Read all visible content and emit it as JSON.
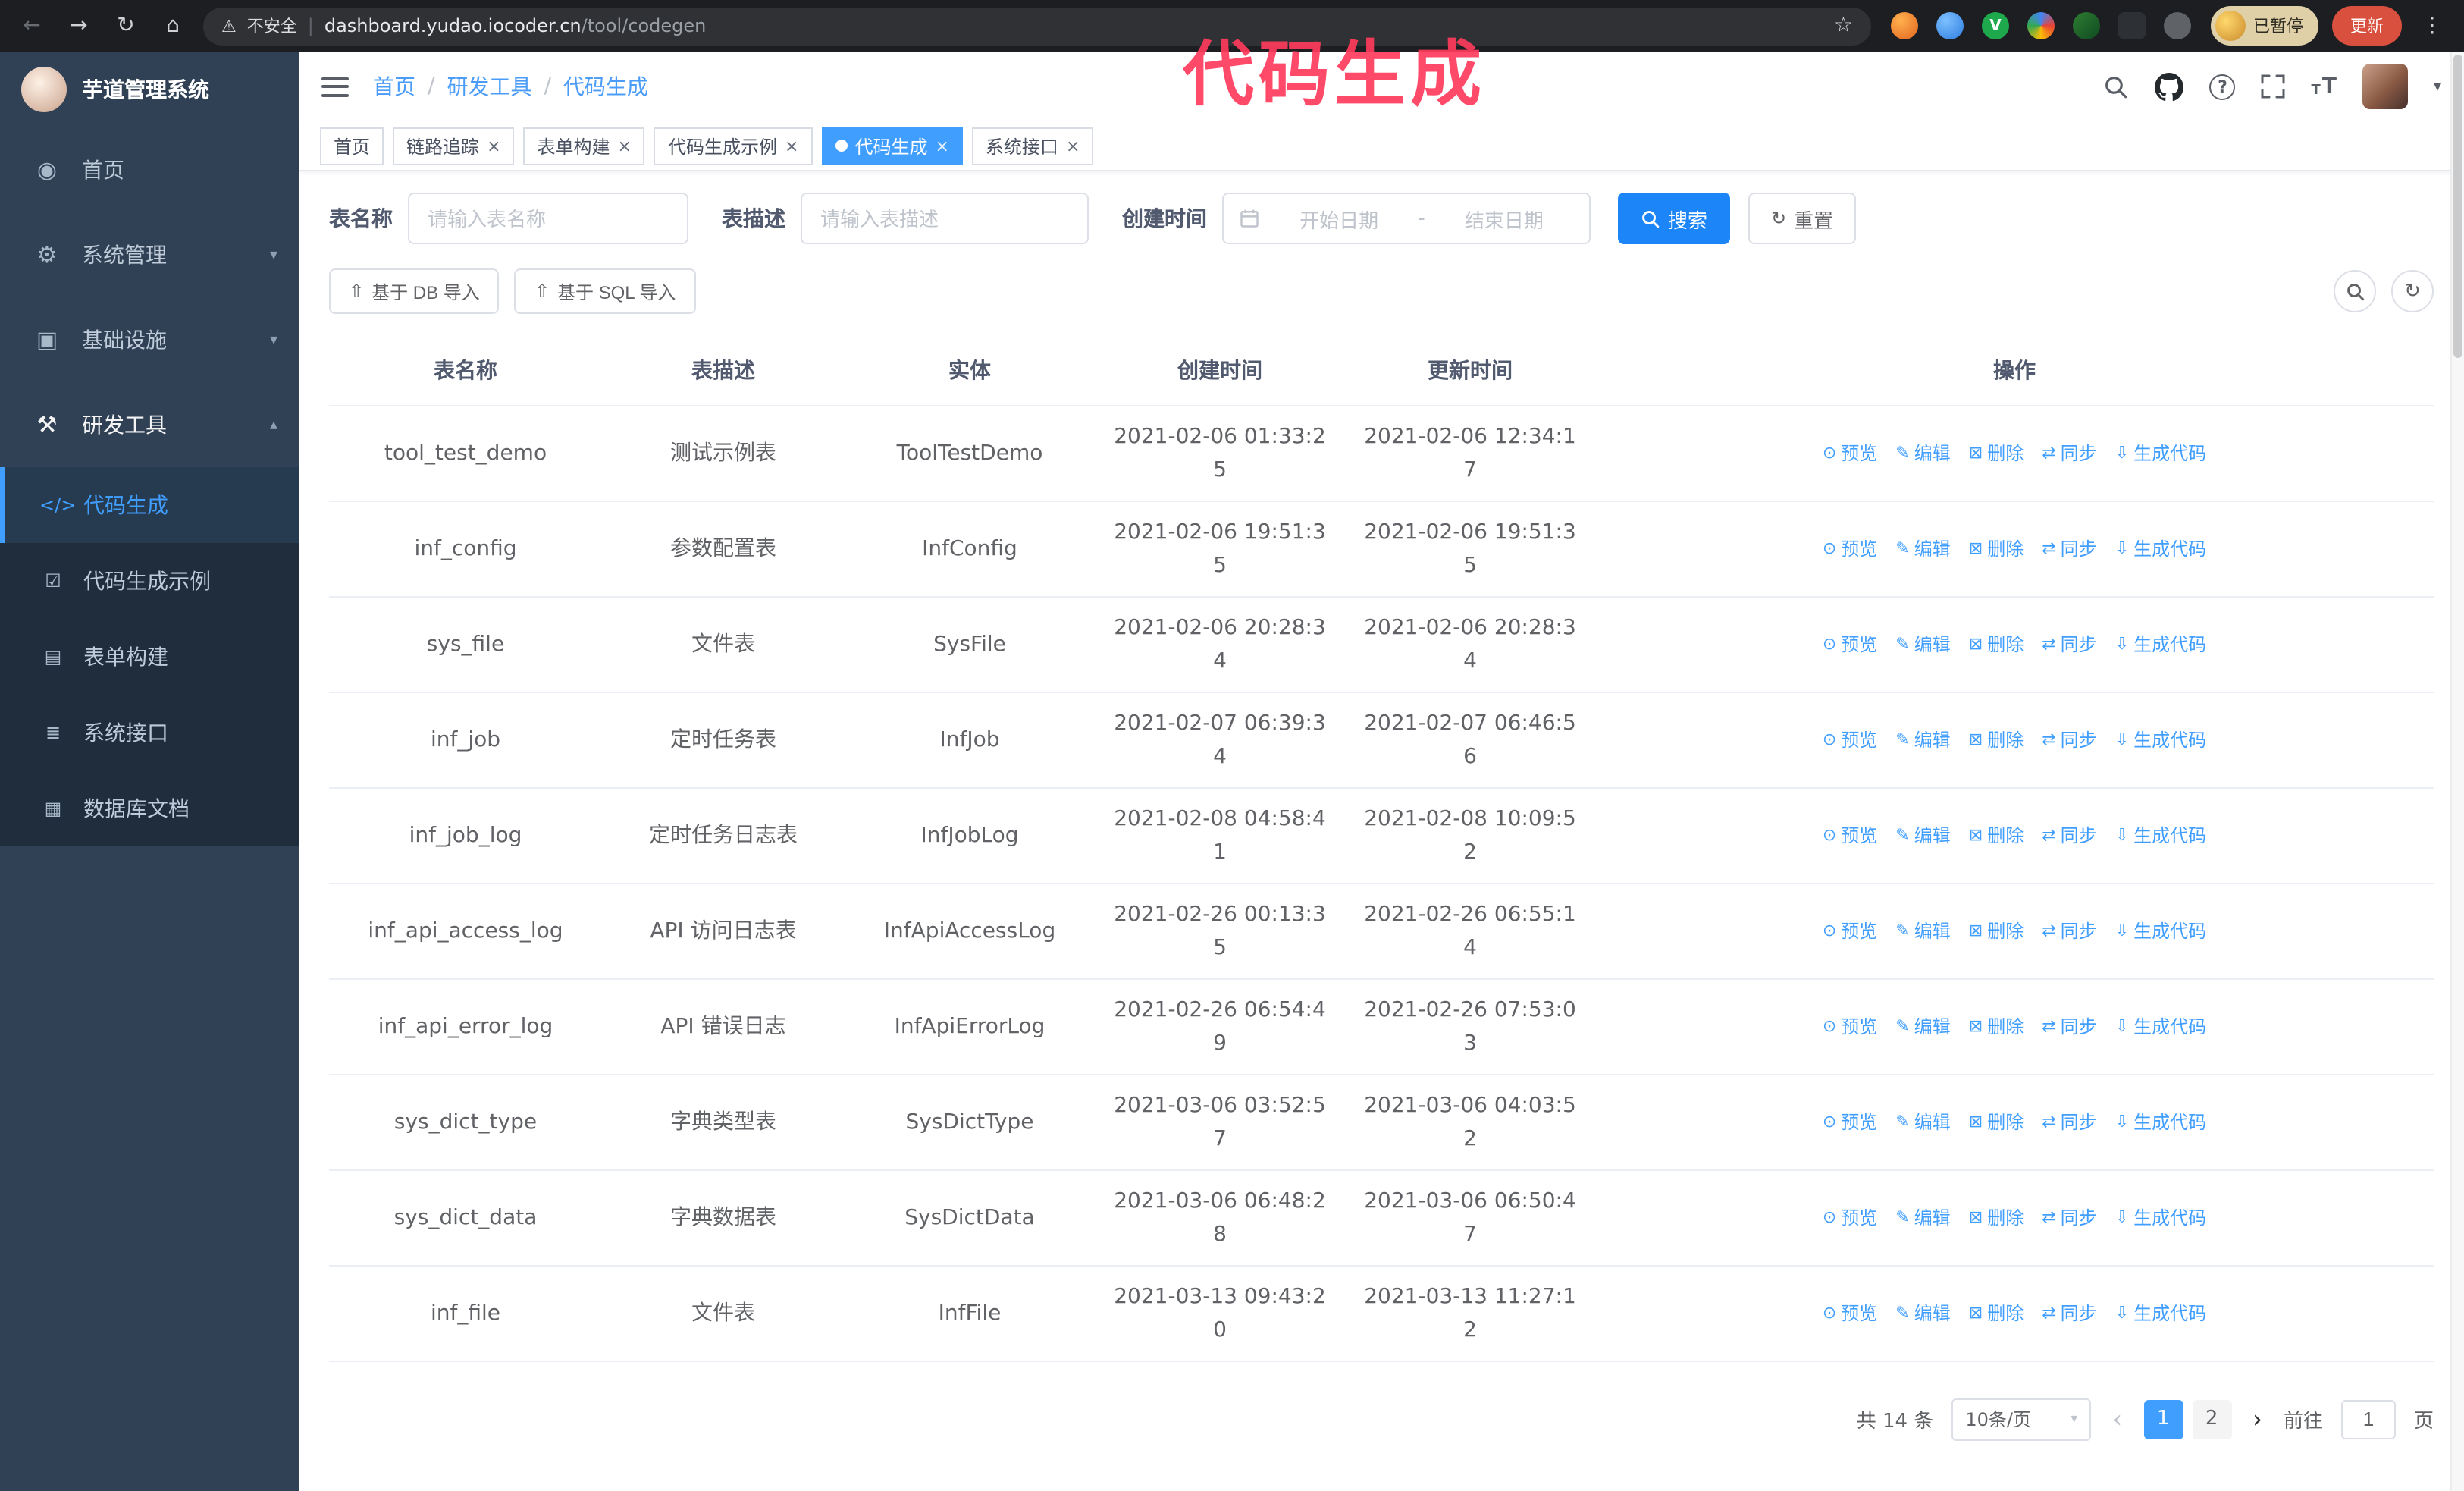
{
  "colors": {
    "accent": "#409eff",
    "primary_button": "#1c86f9",
    "sidebar_bg": "#304156",
    "submenu_bg": "#1f2d3d",
    "annotation": "#ff3b5c",
    "active_tab_bg": "#409eff"
  },
  "icons": {
    "back": "←",
    "forward": "→",
    "reload": "↻",
    "home": "⌂",
    "warning": "⚠",
    "star": "☆",
    "kebab": "⋮",
    "ext_v": "V",
    "dashboard": "◉",
    "gear": "⚙",
    "infrastructure": "▣",
    "devtools": "⚒",
    "code": "</>",
    "example": "☑",
    "form": "▤",
    "api": "≣",
    "database": "▦",
    "preview": "⊙",
    "edit": "✎",
    "delete": "⊠",
    "sync": "⇄",
    "generate": "⇩",
    "chevron_down": "▾",
    "chevron_up": "▴",
    "refresh": "↻",
    "upload": "⇧",
    "help": "?",
    "close": "×",
    "font_size_small": "T",
    "font_size_large": "T",
    "prev": "‹",
    "next": "›"
  },
  "browser": {
    "security_label": "不安全",
    "url_domain": "dashboard.yudao.iocoder.cn",
    "url_path": "/tool/codegen",
    "paused_badge": "已暂停",
    "update_button": "更新"
  },
  "annotation": {
    "text": "代码生成"
  },
  "sidebar": {
    "title": "芋道管理系统",
    "items": [
      {
        "id": "home",
        "label": "首页",
        "icon": "dashboard",
        "chevron": null,
        "open": false
      },
      {
        "id": "system",
        "label": "系统管理",
        "icon": "gear",
        "chevron": "down",
        "open": false
      },
      {
        "id": "infrastructure",
        "label": "基础设施",
        "icon": "infrastructure",
        "chevron": "down",
        "open": false
      },
      {
        "id": "devtools",
        "label": "研发工具",
        "icon": "devtools",
        "chevron": "up",
        "open": true
      }
    ],
    "sub_items": [
      {
        "id": "codegen",
        "label": "代码生成",
        "icon": "code",
        "active": true
      },
      {
        "id": "codegen-example",
        "label": "代码生成示例",
        "icon": "example",
        "active": false
      },
      {
        "id": "form-builder",
        "label": "表单构建",
        "icon": "form",
        "active": false
      },
      {
        "id": "api",
        "label": "系统接口",
        "icon": "api",
        "active": false
      },
      {
        "id": "db-doc",
        "label": "数据库文档",
        "icon": "database",
        "active": false
      }
    ]
  },
  "header": {
    "breadcrumb": [
      "首页",
      "研发工具",
      "代码生成"
    ]
  },
  "tabs": [
    {
      "id": "home",
      "label": "首页",
      "closable": false,
      "active": false
    },
    {
      "id": "tracing",
      "label": "链路追踪",
      "closable": true,
      "active": false
    },
    {
      "id": "form-builder",
      "label": "表单构建",
      "closable": true,
      "active": false
    },
    {
      "id": "codegen-example",
      "label": "代码生成示例",
      "closable": true,
      "active": false
    },
    {
      "id": "codegen",
      "label": "代码生成",
      "closable": true,
      "active": true
    },
    {
      "id": "api",
      "label": "系统接口",
      "closable": true,
      "active": false
    }
  ],
  "filters": {
    "table_name_label": "表名称",
    "table_name_placeholder": "请输入表名称",
    "table_desc_label": "表描述",
    "table_desc_placeholder": "请输入表描述",
    "create_time_label": "创建时间",
    "date_start_placeholder": "开始日期",
    "date_separator": "-",
    "date_end_placeholder": "结束日期",
    "search_button": "搜索",
    "reset_button": "重置"
  },
  "toolbar": {
    "import_db": "基于 DB 导入",
    "import_sql": "基于 SQL 导入"
  },
  "table": {
    "columns": [
      "表名称",
      "表描述",
      "实体",
      "创建时间",
      "更新时间",
      "操作"
    ],
    "actions": [
      {
        "id": "preview",
        "label": "预览",
        "icon": "preview"
      },
      {
        "id": "edit",
        "label": "编辑",
        "icon": "edit"
      },
      {
        "id": "delete",
        "label": "删除",
        "icon": "delete"
      },
      {
        "id": "sync",
        "label": "同步",
        "icon": "sync"
      },
      {
        "id": "generate",
        "label": "生成代码",
        "icon": "generate"
      }
    ],
    "rows": [
      {
        "name": "tool_test_demo",
        "desc": "测试示例表",
        "entity": "ToolTestDemo",
        "created": "2021-02-06 01:33:25",
        "updated": "2021-02-06 12:34:17"
      },
      {
        "name": "inf_config",
        "desc": "参数配置表",
        "entity": "InfConfig",
        "created": "2021-02-06 19:51:35",
        "updated": "2021-02-06 19:51:35"
      },
      {
        "name": "sys_file",
        "desc": "文件表",
        "entity": "SysFile",
        "created": "2021-02-06 20:28:34",
        "updated": "2021-02-06 20:28:34"
      },
      {
        "name": "inf_job",
        "desc": "定时任务表",
        "entity": "InfJob",
        "created": "2021-02-07 06:39:34",
        "updated": "2021-02-07 06:46:56"
      },
      {
        "name": "inf_job_log",
        "desc": "定时任务日志表",
        "entity": "InfJobLog",
        "created": "2021-02-08 04:58:41",
        "updated": "2021-02-08 10:09:52"
      },
      {
        "name": "inf_api_access_log",
        "desc": "API 访问日志表",
        "entity": "InfApiAccessLog",
        "created": "2021-02-26 00:13:35",
        "updated": "2021-02-26 06:55:14"
      },
      {
        "name": "inf_api_error_log",
        "desc": "API 错误日志",
        "entity": "InfApiErrorLog",
        "created": "2021-02-26 06:54:49",
        "updated": "2021-02-26 07:53:03"
      },
      {
        "name": "sys_dict_type",
        "desc": "字典类型表",
        "entity": "SysDictType",
        "created": "2021-03-06 03:52:57",
        "updated": "2021-03-06 04:03:52"
      },
      {
        "name": "sys_dict_data",
        "desc": "字典数据表",
        "entity": "SysDictData",
        "created": "2021-03-06 06:48:28",
        "updated": "2021-03-06 06:50:47"
      },
      {
        "name": "inf_file",
        "desc": "文件表",
        "entity": "InfFile",
        "created": "2021-03-13 09:43:20",
        "updated": "2021-03-13 11:27:12"
      }
    ]
  },
  "pagination": {
    "total": "共 14 条",
    "page_size": "10条/页",
    "pages": [
      "1",
      "2"
    ],
    "active_page": "1",
    "goto_label": "前往",
    "goto_value": "1",
    "goto_suffix": "页"
  }
}
